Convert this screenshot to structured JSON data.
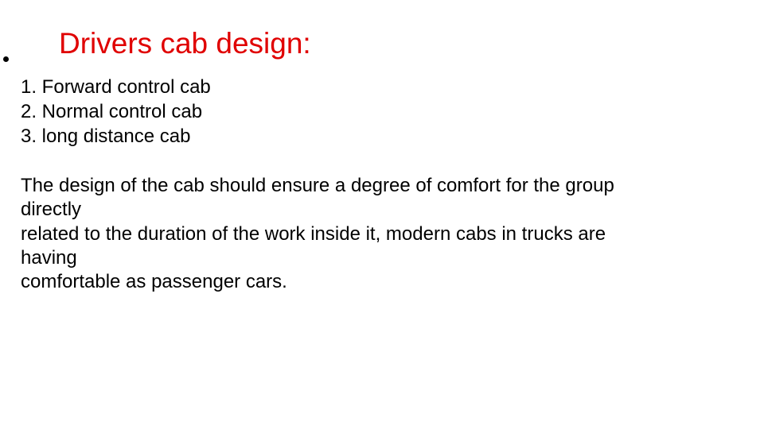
{
  "slide": {
    "title": "Drivers cab design:",
    "title_color": "#e00000",
    "list_items": [
      "1. Forward control cab",
      "2. Normal control cab",
      "3. long distance cab"
    ],
    "paragraph_lines": [
      "The design of the cab should ensure a degree of comfort for the group",
      "directly",
      "related to the duration of the work inside it, modern cabs in trucks are",
      "having",
      "comfortable as passenger cars."
    ]
  }
}
